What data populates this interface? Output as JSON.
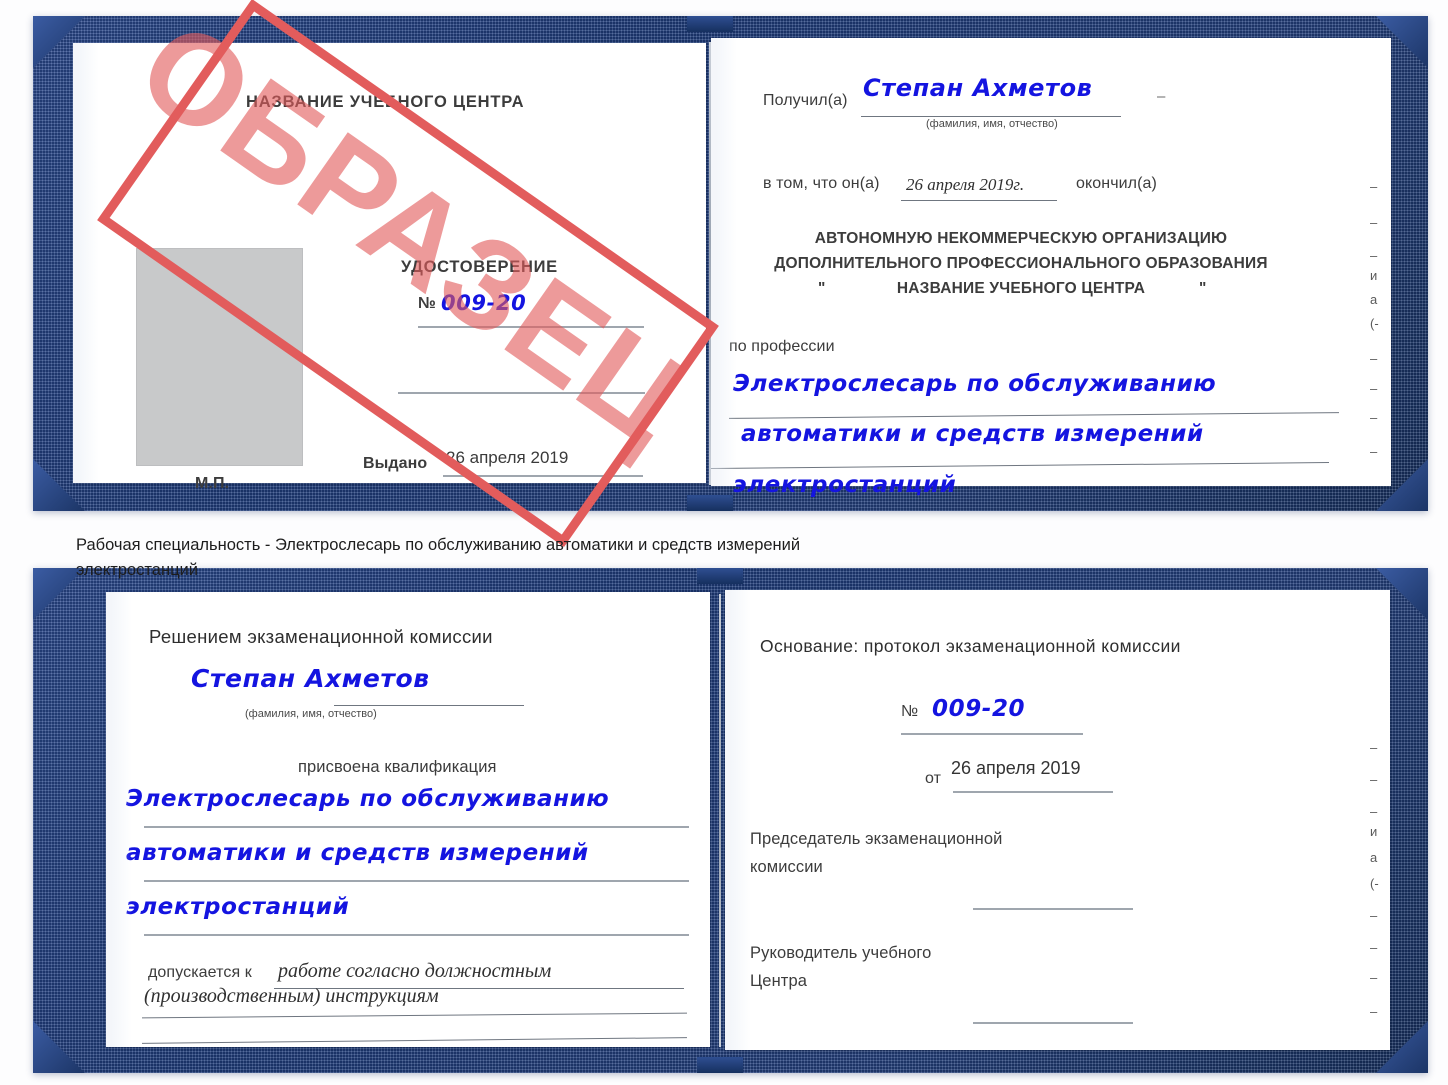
{
  "caption": {
    "line1": "Рабочая специальность - Электрослесарь по обслуживанию автоматики и средств измерений",
    "line2": "электростанций"
  },
  "stamp": {
    "word": "ОБРАЗЕЦ",
    "color": "#e25c5c"
  },
  "certificate_1": {
    "left_page": {
      "org_title": "НАЗВАНИЕ УЧЕБНОГО ЦЕНТРА",
      "doc_type": "УДОСТОВЕРЕНИЕ",
      "number_label": "№",
      "number_value": "009-20",
      "issued_label": "Выдано",
      "issued_value": "26 апреля 2019",
      "seal_label": "М.П."
    },
    "right_page": {
      "received_label": "Получил(а)",
      "received_value": "Степан Ахметов",
      "fio_hint": "(фамилия, имя, отчество)",
      "in_that_label": "в том, что он(а)",
      "in_that_value": "26 апреля 2019г.",
      "finished_label": "окончил(а)",
      "org_line1": "АВТОНОМНУЮ НЕКОММЕРЧЕСКУЮ ОРГАНИЗАЦИЮ",
      "org_line2": "ДОПОЛНИТЕЛЬНОГО ПРОФЕССИОНАЛЬНОГО ОБРАЗОВАНИЯ",
      "org_quote_open": "\"",
      "org_line3": "НАЗВАНИЕ УЧЕБНОГО ЦЕНТРА",
      "org_quote_close": "\"",
      "profession_label": "по профессии",
      "profession_line1": "Электрослесарь по обслуживанию",
      "profession_line2": "автоматики и средств измерений",
      "profession_line3": "электростанций",
      "edge_marks": [
        "–",
        "–",
        "–",
        "и",
        "а",
        "(-",
        "–",
        "–",
        "–",
        "–"
      ]
    }
  },
  "certificate_2": {
    "left_page": {
      "decision_title": "Решением экзаменационной комиссии",
      "name_value": "Степан Ахметов",
      "fio_hint": "(фамилия, имя, отчество)",
      "qualification_label": "присвоена квалификация",
      "qualification_line1": "Электрослесарь по обслуживанию",
      "qualification_line2": "автоматики и средств измерений",
      "qualification_line3": "электростанций",
      "admitted_label": "допускается к",
      "admitted_value_line1": "работе согласно должностным",
      "admitted_value_line2": "(производственным) инструкциям"
    },
    "right_page": {
      "basis_label": "Основание: протокол экзаменационной комиссии",
      "number_label": "№",
      "number_value": "009-20",
      "date_label": "от",
      "date_value": "26 апреля 2019",
      "chairman_line1": "Председатель экзаменационной",
      "chairman_line2": "комиссии",
      "head_line1": "Руководитель учебного",
      "head_line2": "Центра",
      "edge_marks": [
        "–",
        "–",
        "–",
        "и",
        "а",
        "(-",
        "–",
        "–",
        "–",
        "–"
      ]
    }
  }
}
